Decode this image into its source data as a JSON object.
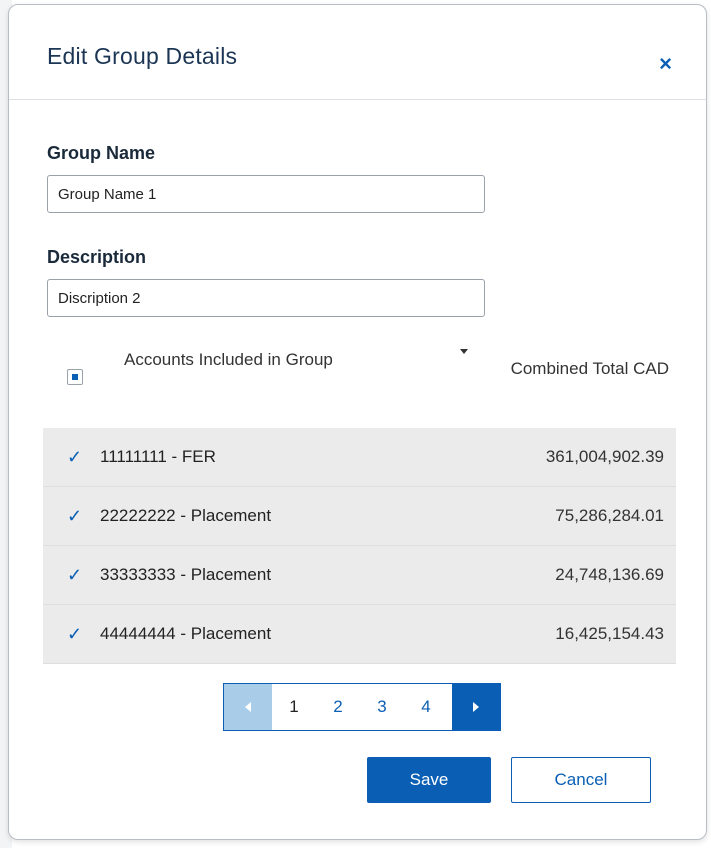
{
  "dialog": {
    "title": "Edit Group Details",
    "close_icon": "close-icon",
    "close_glyph": "×"
  },
  "form": {
    "group_name_label": "Group Name",
    "group_name_value": "Group Name 1",
    "description_label": "Description",
    "description_value": "Discription 2"
  },
  "table": {
    "col_accounts": "Accounts Included in Group",
    "col_total": "Combined Total CAD",
    "check_glyph": "✓",
    "rows": [
      {
        "account": "11111111 - FER",
        "amount": "361,004,902.39",
        "checked": true
      },
      {
        "account": "22222222 - Placement",
        "amount": "75,286,284.01",
        "checked": true
      },
      {
        "account": "33333333 - Placement",
        "amount": "24,748,136.69",
        "checked": true
      },
      {
        "account": "44444444 - Placement",
        "amount": "16,425,154.43",
        "checked": true
      }
    ]
  },
  "pagination": {
    "pages": [
      "1",
      "2",
      "3",
      "4"
    ],
    "current": "1"
  },
  "actions": {
    "save_label": "Save",
    "cancel_label": "Cancel"
  },
  "colors": {
    "accent": "#0a5fb4",
    "row_bg": "#ebebeb",
    "title": "#1b3554"
  }
}
